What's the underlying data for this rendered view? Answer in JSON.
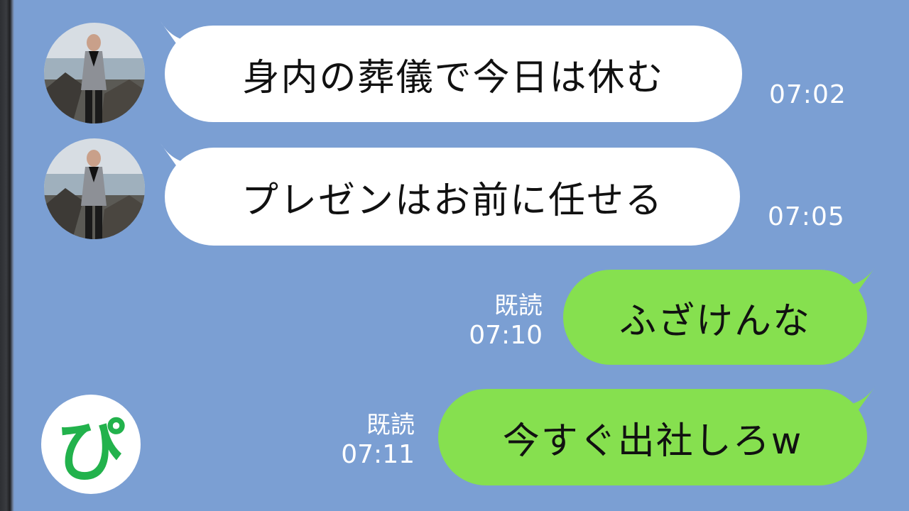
{
  "chat": {
    "background_color": "#7b9fd3",
    "incoming_bubble_color": "#ffffff",
    "outgoing_bubble_color": "#86e04f",
    "messages": [
      {
        "text": "身内の葬儀で今日は休む",
        "time": "07:02"
      },
      {
        "text": "プレゼンはお前に任せる",
        "time": "07:05"
      },
      {
        "text": "ふざけんな",
        "status": "既読",
        "time": "07:10"
      },
      {
        "text": "今すぐ出社しろw",
        "status": "既読",
        "time": "07:11"
      }
    ]
  },
  "logo": {
    "text": "ぴ",
    "color": "#22b24c"
  }
}
